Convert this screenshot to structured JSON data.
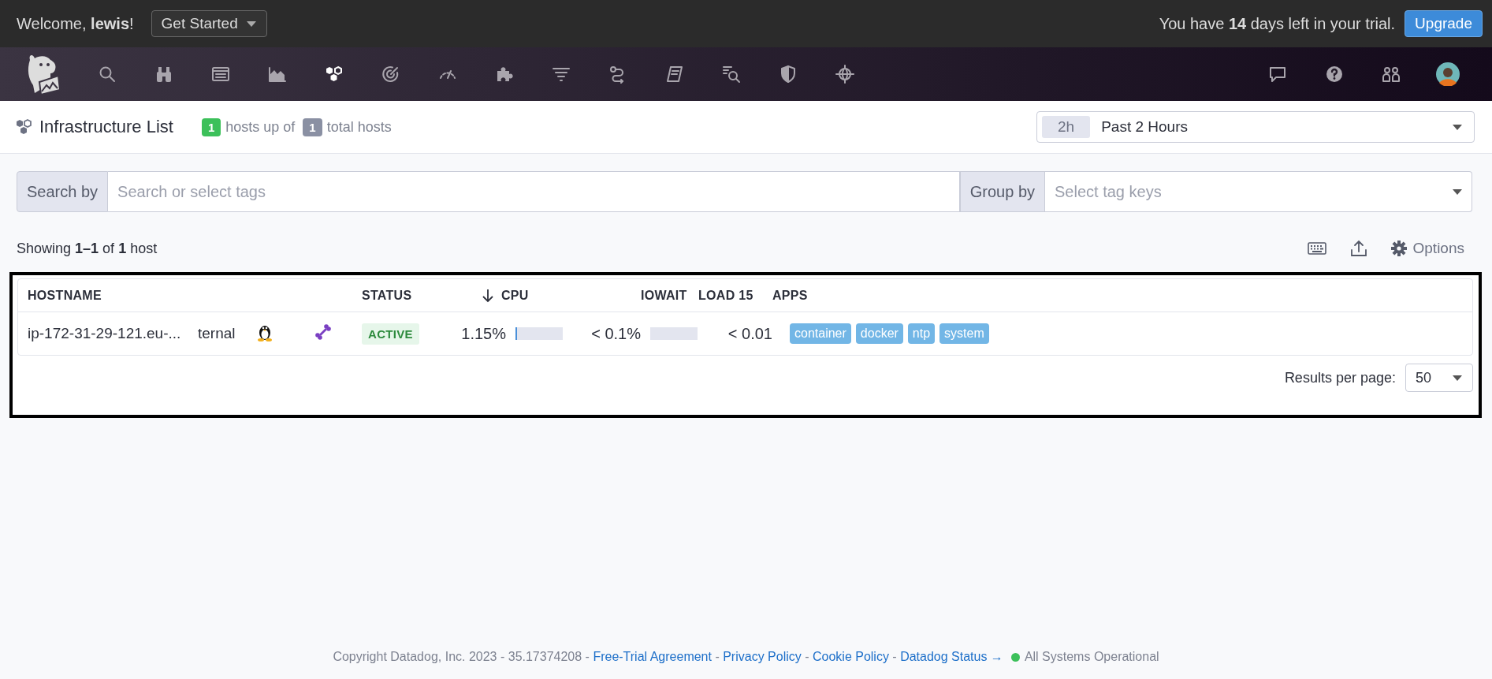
{
  "top_bar": {
    "welcome": "Welcome, **lewis**!",
    "get_started": "Get Started",
    "trial": "You have **14** days left in your trial.",
    "upgrade": "Upgrade"
  },
  "nav": {
    "items": [
      {
        "selected": false
      },
      {
        "selected": false
      },
      {
        "selected": false
      },
      {
        "selected": false
      },
      {
        "selected": true
      },
      {
        "selected": false
      },
      {
        "selected": false
      },
      {
        "selected": false
      },
      {
        "selected": false
      },
      {
        "selected": false
      },
      {
        "selected": false
      },
      {
        "selected": false
      },
      {
        "selected": false
      },
      {
        "selected": false
      }
    ]
  },
  "header": {
    "title": "Infrastructure List",
    "up_count": "1",
    "up_label": "hosts up of",
    "total_count": "1",
    "total_label": "total hosts",
    "time_range": {
      "badge": "2h",
      "label": "Past 2 Hours"
    }
  },
  "filters": {
    "search_label": "Search by",
    "search_placeholder": "Search or select tags",
    "group_label": "Group by",
    "group_placeholder": "Select tag keys"
  },
  "toolbar": {
    "showing": "Showing **1–1** of **1** host",
    "options": "Options"
  },
  "table": {
    "columns": [
      {
        "label": "HOSTNAME",
        "sorted": false
      },
      {
        "label": "STATUS",
        "sorted": false
      },
      {
        "label": "CPU",
        "sorted": true
      },
      {
        "label": "IOWAIT",
        "sorted": false
      },
      {
        "label": "LOAD 15",
        "sorted": false
      },
      {
        "label": "APPS",
        "sorted": false
      }
    ],
    "rows": [
      {
        "hostname": "ip-172-31-29-121.eu-...",
        "alias": "ternal",
        "status": "ACTIVE",
        "cpu": "1.15%",
        "cpu_bar": {
          "level": 0.0115
        },
        "iowait": "< 0.1%",
        "iowait_bar": {
          "level": 0.0
        },
        "load15": "< 0.01",
        "apps": [
          "container",
          "docker",
          "ntp",
          "system"
        ]
      }
    ]
  },
  "pagination": {
    "label": "Results per page:",
    "value": "50"
  },
  "footer": {
    "parts": [
      {
        "kind": "text",
        "text": "Copyright Datadog, Inc. 2023 - 35.17374208 - "
      },
      {
        "kind": "link",
        "text": "Free-Trial Agreement"
      },
      {
        "kind": "text",
        "text": " - "
      },
      {
        "kind": "link",
        "text": "Privacy Policy"
      },
      {
        "kind": "text",
        "text": " - "
      },
      {
        "kind": "link",
        "text": "Cookie Policy"
      },
      {
        "kind": "text",
        "text": " - "
      },
      {
        "kind": "link",
        "text": "Datadog Status →"
      }
    ],
    "status": "All Systems Operational"
  }
}
